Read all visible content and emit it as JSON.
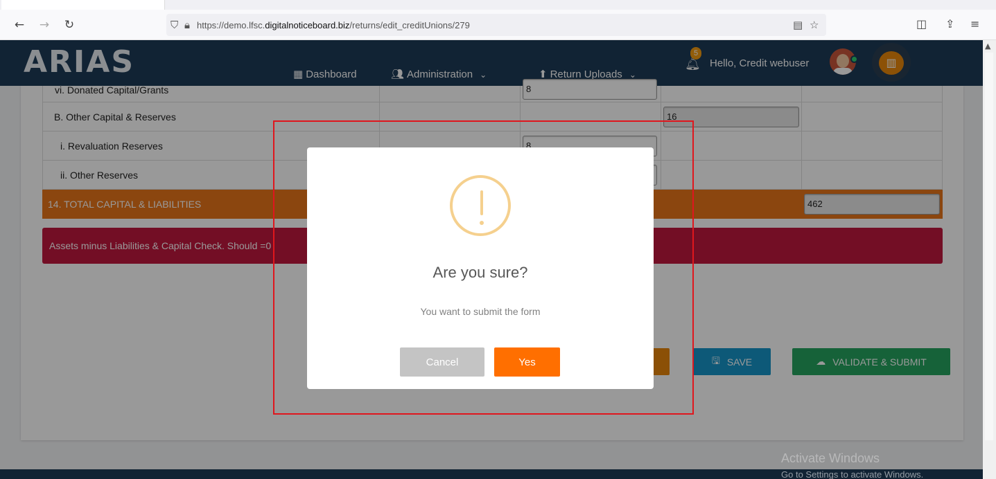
{
  "browser": {
    "url_prefix": "https://demo.lfsc.",
    "url_domain": "digitalnoticeboard.biz",
    "url_path": "/returns/edit_creditUnions/279",
    "icons": [
      "back-icon",
      "forward-icon",
      "reload-icon",
      "shield-icon",
      "lock-icon",
      "reader-icon",
      "bookmark-star-icon",
      "pocket-icon",
      "share-icon",
      "menu-icon"
    ]
  },
  "header": {
    "logo": "ARIAS",
    "nav": [
      {
        "label": "Dashboard",
        "icon": "dashboard-icon"
      },
      {
        "label": "Administration",
        "icon": "users-icon"
      },
      {
        "label": "Return Uploads",
        "icon": "upload-icon"
      }
    ],
    "notification_count": "5",
    "greeting": "Hello, Credit webuser"
  },
  "table": {
    "rows": [
      {
        "label": "vi. Donated Capital/Grants",
        "value": "8"
      },
      {
        "label": "B. Other Capital & Reserves",
        "value": "16"
      },
      {
        "label": "i. Revaluation Reserves",
        "value": "8"
      },
      {
        "label": "ii. Other Reserves",
        "value": ""
      }
    ],
    "total_label": "14. TOTAL CAPITAL & LIABILITIES",
    "total_value": "462"
  },
  "alert": {
    "text": "Assets minus Liabilities & Capital Check. Should =0"
  },
  "actions": {
    "save": "SAVE",
    "validate_submit": "VALIDATE & SUBMIT"
  },
  "modal": {
    "title": "Are you sure?",
    "text": "You want to submit the form",
    "cancel": "Cancel",
    "confirm": "Yes"
  },
  "watermark": {
    "line1": "Activate Windows",
    "line2": "Go to Settings to activate Windows."
  },
  "colors": {
    "header": "#1d3b57",
    "total_row": "#e8751a",
    "alert": "#c0183f",
    "save": "#1795c9",
    "validate": "#25a45f",
    "confirm": "#ff6f00",
    "cancel": "#c4c4c4",
    "highlight": "#e0161d"
  }
}
